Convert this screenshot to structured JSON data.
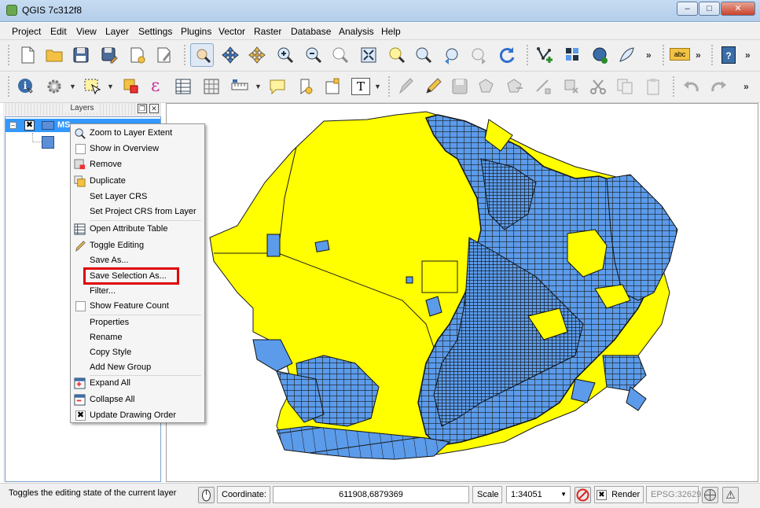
{
  "window": {
    "title": "QGIS 7c312f8",
    "minimize_glyph": "–",
    "maximize_glyph": "□",
    "close_glyph": "✕"
  },
  "menubar": [
    "Project",
    "Edit",
    "View",
    "Layer",
    "Settings",
    "Plugins",
    "Vector",
    "Raster",
    "Database",
    "Analysis",
    "Help"
  ],
  "toolbar": {
    "more_glyph": "»",
    "label_icon_text": "abc",
    "help_icon_text": "?",
    "epsilon_glyph": "ε",
    "text_tool_glyph": "T"
  },
  "layers_panel": {
    "title": "Layers",
    "float_glyph": "❐",
    "close_glyph": "✕",
    "layer_name": "MS",
    "layer_checked_glyph": "✖",
    "expander_glyph": "–"
  },
  "context_menu": {
    "items": [
      {
        "label": "Zoom to Layer Extent",
        "icon": "zoom-layer-icon"
      },
      {
        "label": "Show in Overview",
        "icon": "checkbox"
      },
      {
        "label": "Remove",
        "icon": "remove-layer-icon"
      },
      {
        "label": "Duplicate",
        "icon": "duplicate-icon"
      },
      {
        "label": "Set Layer CRS",
        "icon": ""
      },
      {
        "label": "Set Project CRS from Layer",
        "icon": ""
      },
      {
        "label": "Open Attribute Table",
        "icon": "attribute-table-icon"
      },
      {
        "label": "Toggle Editing",
        "icon": "pencil-icon"
      },
      {
        "label": "Save As...",
        "icon": ""
      },
      {
        "label": "Save Selection As...",
        "icon": ""
      },
      {
        "label": "Filter...",
        "icon": ""
      },
      {
        "label": "Show Feature Count",
        "icon": "checkbox"
      },
      {
        "label": "Properties",
        "icon": ""
      },
      {
        "label": "Rename",
        "icon": ""
      },
      {
        "label": "Copy Style",
        "icon": ""
      },
      {
        "label": "Add New Group",
        "icon": ""
      },
      {
        "label": "Expand All",
        "icon": "expand-all-icon"
      },
      {
        "label": "Collapse All",
        "icon": "collapse-all-icon"
      },
      {
        "label": "Update Drawing Order",
        "icon": "checked-x"
      }
    ],
    "update_order_glyph": "✖"
  },
  "statusbar": {
    "message": "Toggles the editing state of the current layer",
    "coordinate_label": "Coordinate:",
    "coordinate_value": "611908,6879369",
    "scale_label": "Scale",
    "scale_value": "1:34051",
    "dropdown_glyph": "▼",
    "render_glyph": "✖",
    "render_label": "Render",
    "crs": "EPSG:32629",
    "warning_glyph": "⚠"
  },
  "colors": {
    "land": "#ffff00",
    "parcel": "#5b9bea",
    "outline": "#1a1a1a",
    "selection": "#3399ff",
    "highlight": "#e00000"
  }
}
